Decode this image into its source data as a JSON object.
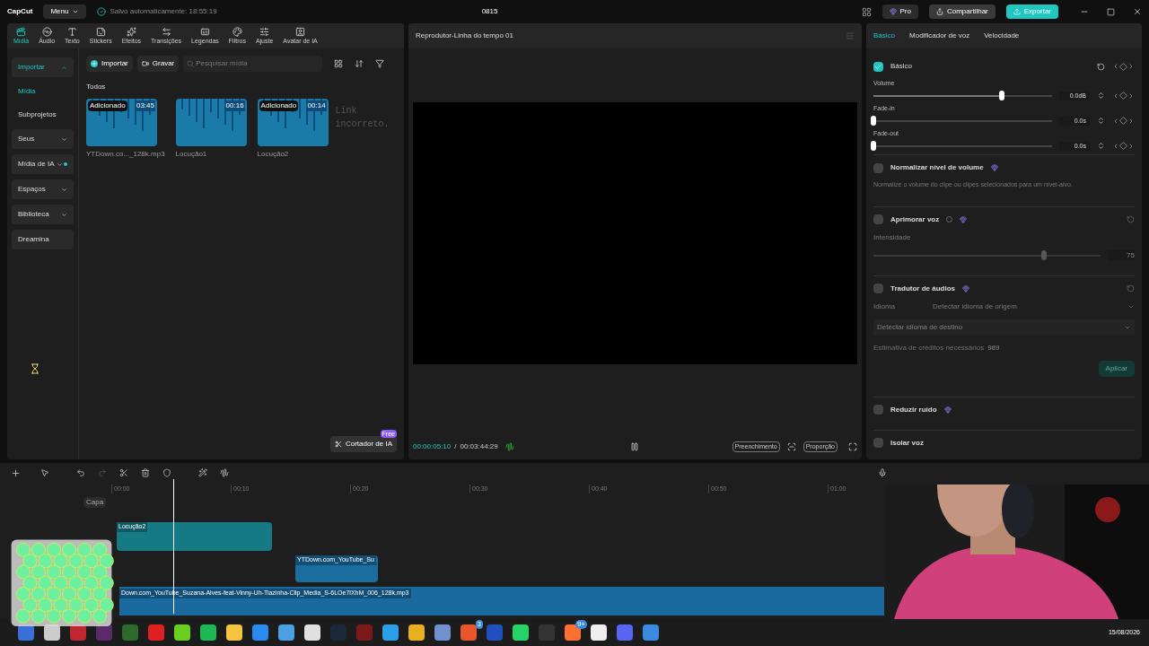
{
  "app": {
    "logo": "CapCut",
    "menu": "Menu",
    "autosave": "Salvo automaticamente: 18:55:19",
    "project_title": "0815",
    "pro": "Pro",
    "share": "Compartilhar",
    "export": "Exportar"
  },
  "toolbar_tabs": [
    {
      "label": "Mídia",
      "selected": true
    },
    {
      "label": "Áudio",
      "selected": false
    },
    {
      "label": "Texto",
      "selected": false
    },
    {
      "label": "Stickers",
      "selected": false
    },
    {
      "label": "Efeitos",
      "selected": false
    },
    {
      "label": "Transições",
      "selected": false
    },
    {
      "label": "Legendas",
      "selected": false
    },
    {
      "label": "Filtros",
      "selected": false
    },
    {
      "label": "Ajuste",
      "selected": false
    },
    {
      "label": "Avatar de IA",
      "selected": false
    }
  ],
  "media_sidebar": [
    {
      "label": "Importar",
      "kind": "group",
      "selected": true,
      "expanded": true,
      "dot": false
    },
    {
      "label": "Mídia",
      "kind": "sub",
      "selected": true
    },
    {
      "label": "Subprojetos",
      "kind": "sub",
      "selected": false
    },
    {
      "label": "Seus",
      "kind": "group",
      "selected": false,
      "expanded": false,
      "dot": false
    },
    {
      "label": "Mídia de IA",
      "kind": "group",
      "selected": false,
      "expanded": false,
      "dot": true
    },
    {
      "label": "Espaços",
      "kind": "group",
      "selected": false,
      "expanded": false,
      "dot": false
    },
    {
      "label": "Biblioteca",
      "kind": "group",
      "selected": false,
      "expanded": false,
      "dot": false
    },
    {
      "label": "Dreamina",
      "kind": "plain",
      "selected": false
    }
  ],
  "media_bar": {
    "import": "Importar",
    "record": "Gravar",
    "search_placeholder": "Pesquisar mídia",
    "filter": "Todos"
  },
  "media_items": [
    {
      "name": "YTDown.co..._128k.mp3",
      "duration": "03:45",
      "added": "Adicionado"
    },
    {
      "name": "Locução1",
      "duration": "00:16"
    },
    {
      "name": "Locução2",
      "duration": "00:14",
      "added": "Adicionado"
    }
  ],
  "overlay_caption": "Link incorreto.",
  "ai_cutter": {
    "label": "Cortador de IA",
    "badge": "Free"
  },
  "player": {
    "title": "Reprodutor-Linha do tempo 01",
    "current": "00:00:05:10",
    "separator": "/",
    "total": "00:03:44:29",
    "fill": "Preenchimento",
    "ratio": "Proporção"
  },
  "inspector": {
    "tabs": [
      {
        "label": "Básico",
        "selected": true
      },
      {
        "label": "Modificador de voz",
        "selected": false
      },
      {
        "label": "Velocidade",
        "selected": false
      }
    ],
    "basic": {
      "title": "Básico",
      "checked": true
    },
    "sliders": [
      {
        "label": "Volume",
        "level": 0.72,
        "value": "0.0dB"
      },
      {
        "label": "Fade-in",
        "level": 0,
        "value": "0.0s"
      },
      {
        "label": "Fade-out",
        "level": 0,
        "value": "0.0s"
      }
    ],
    "normalize": {
      "title": "Normalizar nível de volume",
      "checked": false,
      "description": "Normalize o volume do clipe ou clipes selecionados para um nível-alvo."
    },
    "enhance": {
      "title": "Aprimorar voz",
      "checked": false,
      "intensity_label": "Intensidade",
      "level": 0.75,
      "value": "75"
    },
    "translator": {
      "title": "Tradutor de áudios",
      "checked": false,
      "language_label": "Idioma",
      "source": "Detectar idioma de origem",
      "target": "Detectar idioma de destino",
      "credits_label": "Estimativa de créditos necessários",
      "credits": "989",
      "apply": "Aplicar"
    },
    "noise": {
      "title": "Reduzir ruído",
      "checked": false
    },
    "isolate": {
      "title": "Isolar voz",
      "checked": false
    }
  },
  "timeline": {
    "ruler": [
      "00:00",
      "00:10",
      "00:20",
      "00:30",
      "00:40",
      "00:50",
      "01:00"
    ],
    "cover": "Capa",
    "clips": [
      {
        "name": "Locução2"
      },
      {
        "name": "YTDown.com_YouTube_Su"
      },
      {
        "name": "Down.com_YouTube_Suzana-Alves-feat-Vinny-Uh-Tiazinha-Clip_Media_S-6LOe7lXhM_006_128k.mp3"
      }
    ]
  },
  "taskbar": {
    "apps": [
      {
        "kind": "app"
      },
      {
        "kind": "app"
      },
      {
        "kind": "app"
      },
      {
        "kind": "app"
      },
      {
        "kind": "app"
      },
      {
        "kind": "app"
      },
      {
        "kind": "app"
      },
      {
        "kind": "app"
      },
      {
        "kind": "app"
      },
      {
        "kind": "app"
      },
      {
        "kind": "app"
      },
      {
        "kind": "app"
      },
      {
        "kind": "app"
      },
      {
        "kind": "app"
      },
      {
        "kind": "app"
      },
      {
        "kind": "app"
      },
      {
        "kind": "app"
      },
      {
        "kind": "badged",
        "badge": "3"
      },
      {
        "kind": "app"
      },
      {
        "kind": "app"
      },
      {
        "kind": "app"
      },
      {
        "kind": "badged",
        "badge": "9+"
      },
      {
        "kind": "app"
      },
      {
        "kind": "app"
      },
      {
        "kind": "app"
      }
    ],
    "date": "15/08/2026"
  }
}
